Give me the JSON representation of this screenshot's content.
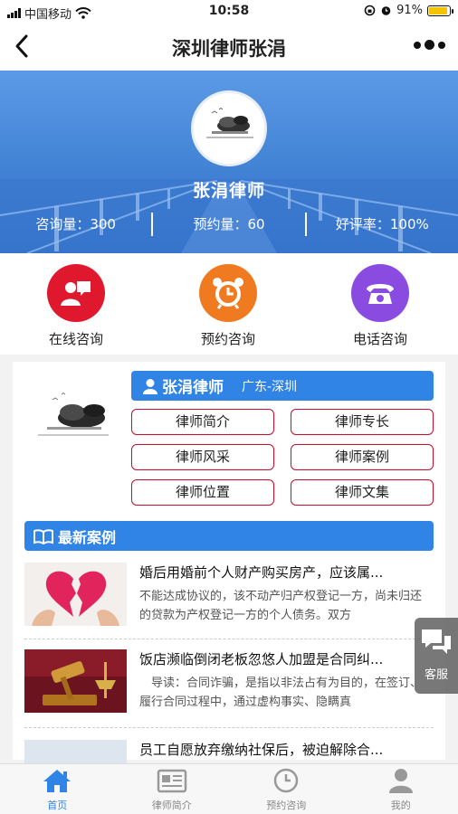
{
  "status_bar": {
    "carrier": "中国移动",
    "time": "10:58",
    "battery": "91%"
  },
  "nav": {
    "title": "深圳律师张涓"
  },
  "banner": {
    "name": "张涓律师",
    "stats": [
      {
        "label": "咨询量：300"
      },
      {
        "label": "预约量：60"
      },
      {
        "label": "好评率：100%"
      }
    ]
  },
  "actions": [
    {
      "label": "在线咨询",
      "color": "#e0182e",
      "icon": "chat-icon"
    },
    {
      "label": "预约咨询",
      "color": "#f07a1f",
      "icon": "alarm-clock-icon"
    },
    {
      "label": "电话咨询",
      "color": "#8a4be0",
      "icon": "telephone-icon"
    }
  ],
  "profile": {
    "name": "张涓律师",
    "location": "广东-深圳",
    "buttons": [
      {
        "label": "律师简介"
      },
      {
        "label": "律师专长"
      },
      {
        "label": "律师风采"
      },
      {
        "label": "律师案例"
      },
      {
        "label": "律师位置"
      },
      {
        "label": "律师文集"
      }
    ]
  },
  "cases": {
    "heading": "最新案例",
    "items": [
      {
        "title": "婚后用婚前个人财产购买房产，应该属...",
        "desc": "不能达成协议的，该不动产归产权登记一方，尚未归还的贷款为产权登记一方的个人债务。双方"
      },
      {
        "title": "饭店濒临倒闭老板忽悠人加盟是合同纠...",
        "desc": "　导读：合同诈骗，是指以非法占有为目的，在签订、履行合同过程中，通过虚构事实、隐瞒真"
      },
      {
        "title": "员工自愿放弃缴纳社保后，被迫解除合...",
        "desc": ""
      }
    ]
  },
  "float_service": {
    "label": "客服"
  },
  "tabs": [
    {
      "label": "首页",
      "active": true
    },
    {
      "label": "律师简介",
      "active": false
    },
    {
      "label": "预约咨询",
      "active": false
    },
    {
      "label": "我的",
      "active": false
    }
  ],
  "colors": {
    "primary": "#2f84e6",
    "button_border": "#c8102e"
  }
}
